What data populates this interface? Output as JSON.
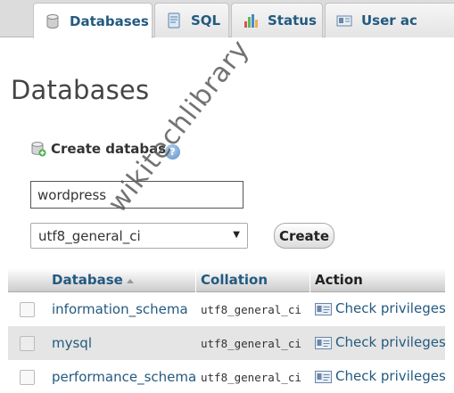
{
  "tabs": [
    {
      "label": "Databases",
      "icon": "database-icon",
      "active": true
    },
    {
      "label": "SQL",
      "icon": "sql-icon",
      "active": false
    },
    {
      "label": "Status",
      "icon": "status-chart-icon",
      "active": false
    },
    {
      "label": "User ac",
      "icon": "user-accounts-icon",
      "active": false
    }
  ],
  "page_title": "Databases",
  "create_db": {
    "label": "Create database",
    "input_value": "wordpress",
    "collation_selected": "utf8_general_ci",
    "button_label": "Create"
  },
  "table": {
    "headers": {
      "database": "Database",
      "collation": "Collation",
      "action": "Action"
    },
    "rows": [
      {
        "name": "information_schema",
        "collation": "utf8_general_ci",
        "action": "Check privileges"
      },
      {
        "name": "mysql",
        "collation": "utf8_general_ci",
        "action": "Check privileges"
      },
      {
        "name": "performance_schema",
        "collation": "utf8_general_ci",
        "action": "Check privileges"
      }
    ]
  },
  "watermark": "wikitechlibrary",
  "colors": {
    "link": "#235a81",
    "row_alt": "#e5e5e5",
    "tabbar": "#dcdcdc"
  }
}
